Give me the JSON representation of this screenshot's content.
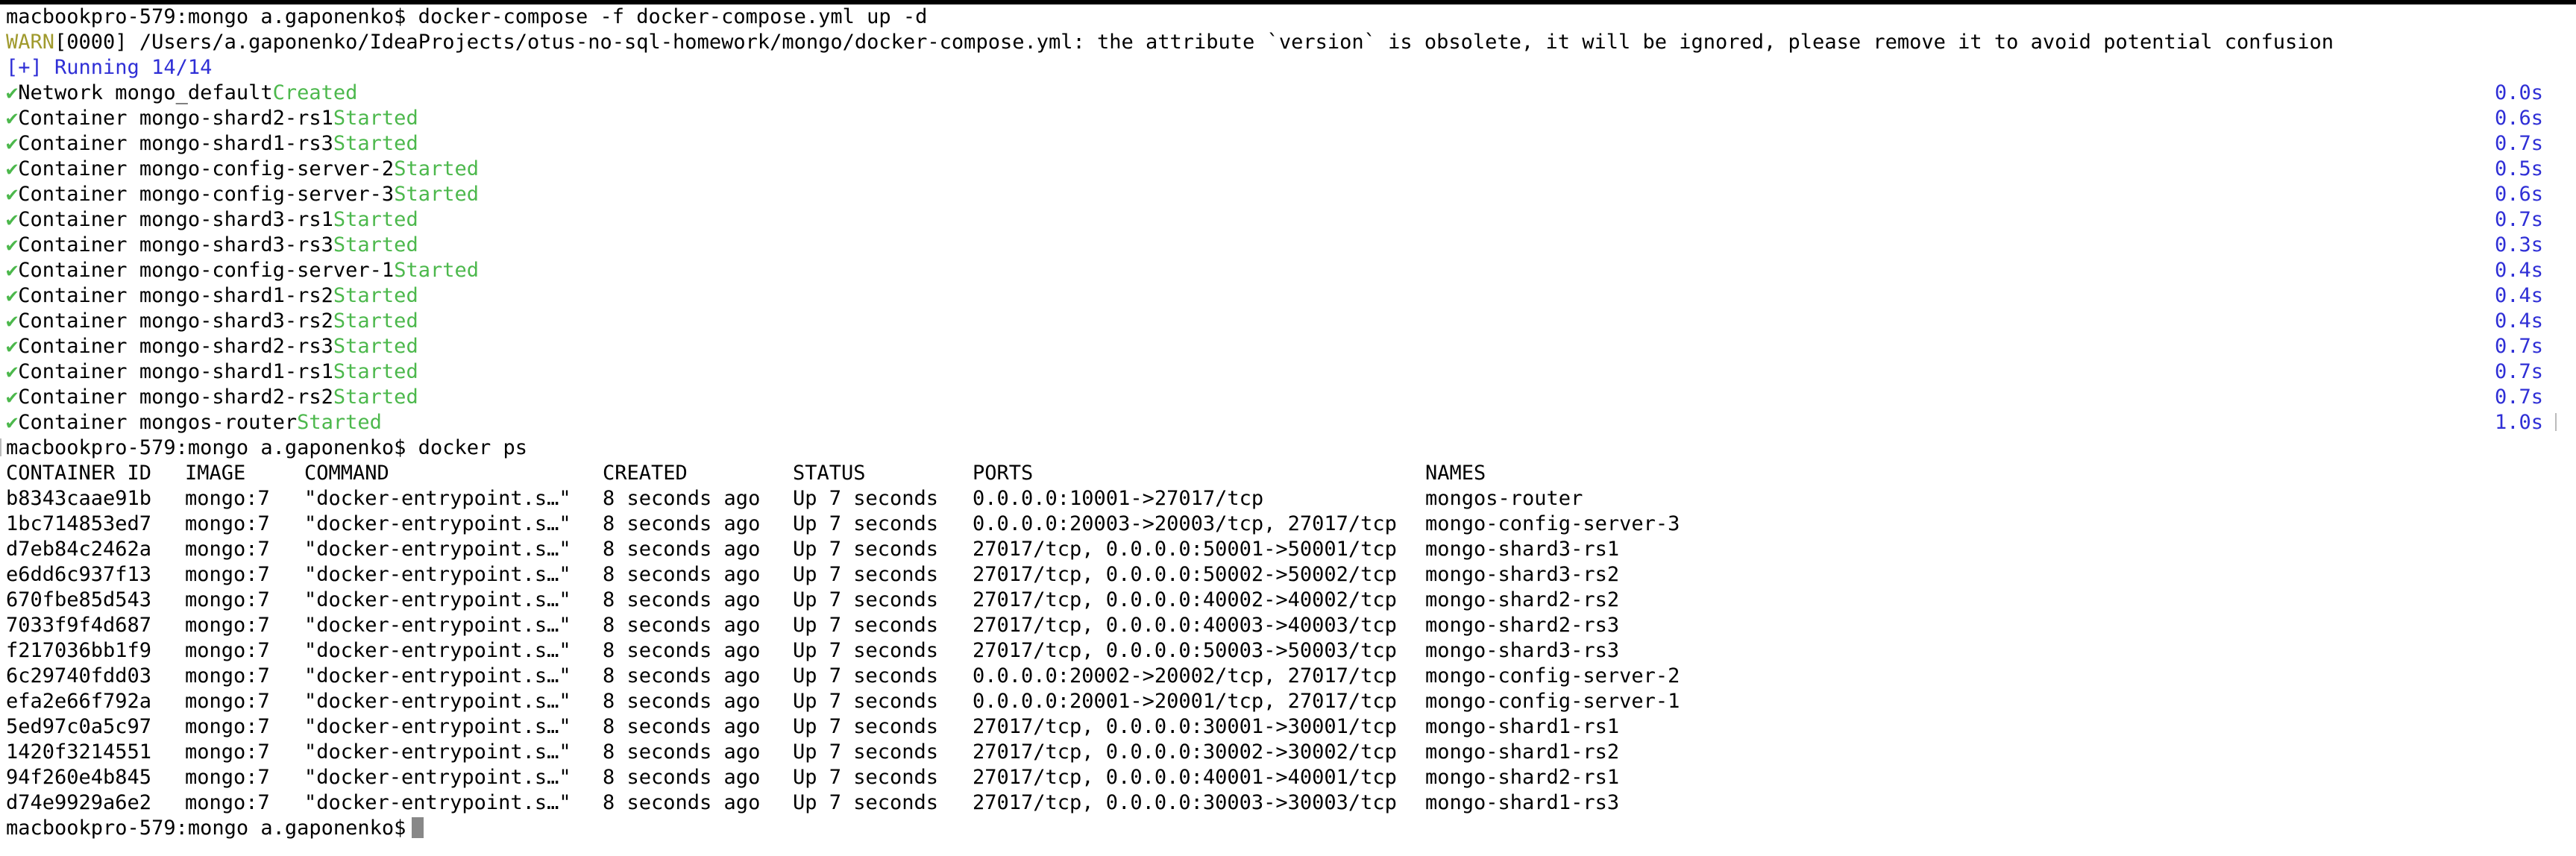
{
  "prompt1": "macbookpro-579:mongo a.gaponenko$ docker-compose -f docker-compose.yml up -d",
  "warn": {
    "prefix": "WARN",
    "message": "[0000] /Users/a.gaponenko/IdeaProjects/otus-no-sql-homework/mongo/docker-compose.yml: the attribute `version` is obsolete, it will be ignored, please remove it to avoid potential confusion"
  },
  "running": "[+] Running 14/14",
  "colors": {
    "warn": "#a09a2d",
    "blue": "#2f2fd6",
    "green": "#4cb84c"
  },
  "services": [
    {
      "check": "✔",
      "name": "Network mongo_default",
      "status": "Created",
      "time": "0.0s"
    },
    {
      "check": "✔",
      "name": "Container mongo-shard2-rs1",
      "status": "Started",
      "time": "0.6s"
    },
    {
      "check": "✔",
      "name": "Container mongo-shard1-rs3",
      "status": "Started",
      "time": "0.7s"
    },
    {
      "check": "✔",
      "name": "Container mongo-config-server-2",
      "status": "Started",
      "time": "0.5s"
    },
    {
      "check": "✔",
      "name": "Container mongo-config-server-3",
      "status": "Started",
      "time": "0.6s"
    },
    {
      "check": "✔",
      "name": "Container mongo-shard3-rs1",
      "status": "Started",
      "time": "0.7s"
    },
    {
      "check": "✔",
      "name": "Container mongo-shard3-rs3",
      "status": "Started",
      "time": "0.3s"
    },
    {
      "check": "✔",
      "name": "Container mongo-config-server-1",
      "status": "Started",
      "time": "0.4s"
    },
    {
      "check": "✔",
      "name": "Container mongo-shard1-rs2",
      "status": "Started",
      "time": "0.4s"
    },
    {
      "check": "✔",
      "name": "Container mongo-shard3-rs2",
      "status": "Started",
      "time": "0.4s"
    },
    {
      "check": "✔",
      "name": "Container mongo-shard2-rs3",
      "status": "Started",
      "time": "0.7s"
    },
    {
      "check": "✔",
      "name": "Container mongo-shard1-rs1",
      "status": "Started",
      "time": "0.7s"
    },
    {
      "check": "✔",
      "name": "Container mongo-shard2-rs2",
      "status": "Started",
      "time": "0.7s"
    },
    {
      "check": "✔",
      "name": "Container mongos-router",
      "status": "Started",
      "time": "1.0s"
    }
  ],
  "prompt2": "macbookpro-579:mongo a.gaponenko$ docker ps",
  "ps": {
    "headers": [
      "CONTAINER ID",
      "IMAGE",
      "COMMAND",
      "CREATED",
      "STATUS",
      "PORTS",
      "NAMES"
    ],
    "rows": [
      [
        "b8343caae91b",
        "mongo:7",
        "\"docker-entrypoint.s…\"",
        "8 seconds ago",
        "Up 7 seconds",
        "0.0.0.0:10001->27017/tcp",
        "mongos-router"
      ],
      [
        "1bc714853ed7",
        "mongo:7",
        "\"docker-entrypoint.s…\"",
        "8 seconds ago",
        "Up 7 seconds",
        "0.0.0.0:20003->20003/tcp, 27017/tcp",
        "mongo-config-server-3"
      ],
      [
        "d7eb84c2462a",
        "mongo:7",
        "\"docker-entrypoint.s…\"",
        "8 seconds ago",
        "Up 7 seconds",
        "27017/tcp, 0.0.0.0:50001->50001/tcp",
        "mongo-shard3-rs1"
      ],
      [
        "e6dd6c937f13",
        "mongo:7",
        "\"docker-entrypoint.s…\"",
        "8 seconds ago",
        "Up 7 seconds",
        "27017/tcp, 0.0.0.0:50002->50002/tcp",
        "mongo-shard3-rs2"
      ],
      [
        "670fbe85d543",
        "mongo:7",
        "\"docker-entrypoint.s…\"",
        "8 seconds ago",
        "Up 7 seconds",
        "27017/tcp, 0.0.0.0:40002->40002/tcp",
        "mongo-shard2-rs2"
      ],
      [
        "7033f9f4d687",
        "mongo:7",
        "\"docker-entrypoint.s…\"",
        "8 seconds ago",
        "Up 7 seconds",
        "27017/tcp, 0.0.0.0:40003->40003/tcp",
        "mongo-shard2-rs3"
      ],
      [
        "f217036bb1f9",
        "mongo:7",
        "\"docker-entrypoint.s…\"",
        "8 seconds ago",
        "Up 7 seconds",
        "27017/tcp, 0.0.0.0:50003->50003/tcp",
        "mongo-shard3-rs3"
      ],
      [
        "6c29740fdd03",
        "mongo:7",
        "\"docker-entrypoint.s…\"",
        "8 seconds ago",
        "Up 7 seconds",
        "0.0.0.0:20002->20002/tcp, 27017/tcp",
        "mongo-config-server-2"
      ],
      [
        "efa2e66f792a",
        "mongo:7",
        "\"docker-entrypoint.s…\"",
        "8 seconds ago",
        "Up 7 seconds",
        "0.0.0.0:20001->20001/tcp, 27017/tcp",
        "mongo-config-server-1"
      ],
      [
        "5ed97c0a5c97",
        "mongo:7",
        "\"docker-entrypoint.s…\"",
        "8 seconds ago",
        "Up 7 seconds",
        "27017/tcp, 0.0.0.0:30001->30001/tcp",
        "mongo-shard1-rs1"
      ],
      [
        "1420f3214551",
        "mongo:7",
        "\"docker-entrypoint.s…\"",
        "8 seconds ago",
        "Up 7 seconds",
        "27017/tcp, 0.0.0.0:30002->30002/tcp",
        "mongo-shard1-rs2"
      ],
      [
        "94f260e4b845",
        "mongo:7",
        "\"docker-entrypoint.s…\"",
        "8 seconds ago",
        "Up 7 seconds",
        "27017/tcp, 0.0.0.0:40001->40001/tcp",
        "mongo-shard2-rs1"
      ],
      [
        "d74e9929a6e2",
        "mongo:7",
        "\"docker-entrypoint.s…\"",
        "8 seconds ago",
        "Up 7 seconds",
        "27017/tcp, 0.0.0.0:30003->30003/tcp",
        "mongo-shard1-rs3"
      ]
    ]
  },
  "prompt3": "macbookpro-579:mongo a.gaponenko$"
}
